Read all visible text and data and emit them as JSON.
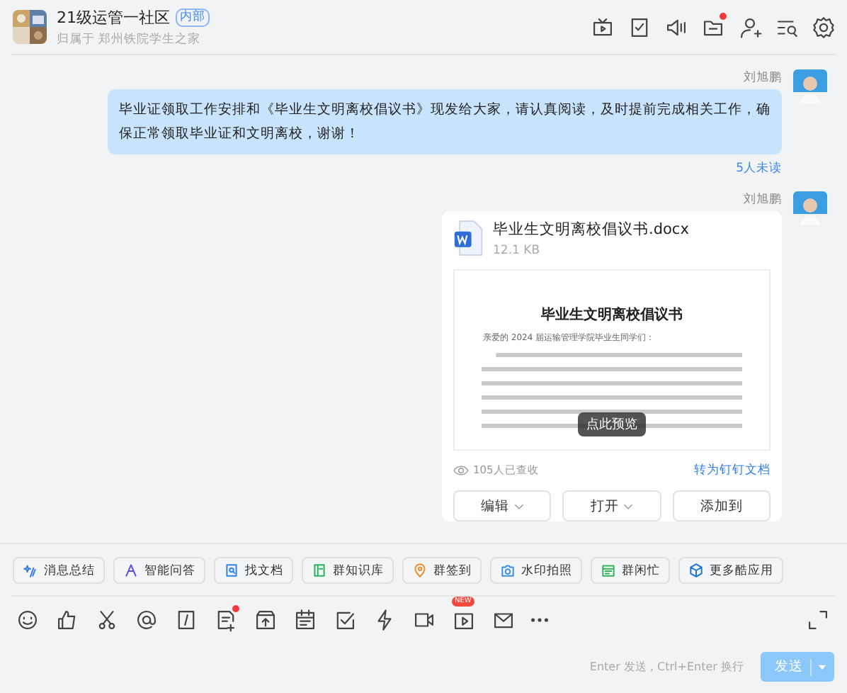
{
  "header": {
    "title": "21级运管一社区",
    "tag": "内部",
    "subtitle": "归属于 郑州铁院学生之家",
    "icons": [
      {
        "kind": "tv",
        "dot": false
      },
      {
        "kind": "check",
        "dot": false
      },
      {
        "kind": "speaker",
        "dot": false
      },
      {
        "kind": "folder",
        "dot": true
      },
      {
        "kind": "add-user",
        "dot": false
      },
      {
        "kind": "search-list",
        "dot": false
      },
      {
        "kind": "settings",
        "dot": false
      }
    ]
  },
  "messages": [
    {
      "kind": "text",
      "sender": "刘旭鹏",
      "text": "毕业证领取工作安排和《毕业生文明离校倡议书》现发给大家，请认真阅读，及时提前完成相关工作，确保正常领取毕业证和文明离校，谢谢！",
      "status": "5人未读"
    },
    {
      "kind": "file",
      "sender": "刘旭鹏",
      "file_name": "毕业生文明离校倡议书.docx",
      "file_size": "12.1 KB",
      "doc_title": "毕业生文明离校倡议书",
      "doc_greeting": "亲爱的 2024 届运输管理学院毕业生同学们：",
      "preview_label": "点此预览",
      "read_count": "105人已查收",
      "convert_link": "转为钉钉文档",
      "actions": [
        {
          "label": "编辑",
          "dropdown": true
        },
        {
          "label": "打开",
          "dropdown": true
        },
        {
          "label": "添加到",
          "dropdown": false
        }
      ]
    }
  ],
  "quick_apps": [
    {
      "kind": "sparkle",
      "label": "消息总结"
    },
    {
      "kind": "ai",
      "label": "智能问答"
    },
    {
      "kind": "doc-search",
      "label": "找文档"
    },
    {
      "kind": "book",
      "label": "群知识库"
    },
    {
      "kind": "pin",
      "label": "群签到"
    },
    {
      "kind": "camera",
      "label": "水印拍照"
    },
    {
      "kind": "calendar",
      "label": "群闲忙"
    },
    {
      "kind": "cube",
      "label": "更多酷应用"
    }
  ],
  "input_tools": [
    {
      "kind": "emoji",
      "dot": false
    },
    {
      "kind": "thumb",
      "dot": false
    },
    {
      "kind": "scissors",
      "dot": false
    },
    {
      "kind": "at",
      "dot": false
    },
    {
      "kind": "slash",
      "dot": false
    },
    {
      "kind": "note",
      "dot": true
    },
    {
      "kind": "upload",
      "dot": false
    },
    {
      "kind": "schedule",
      "dot": false
    },
    {
      "kind": "task",
      "dot": false
    },
    {
      "kind": "flash",
      "dot": false
    },
    {
      "kind": "video",
      "dot": false
    },
    {
      "kind": "live",
      "dot": false,
      "badge": "NEW"
    },
    {
      "kind": "mail",
      "dot": false
    },
    {
      "kind": "more",
      "dot": false
    }
  ],
  "send_hint": "Enter 发送 , Ctrl+Enter 换行",
  "send_button": "发送"
}
